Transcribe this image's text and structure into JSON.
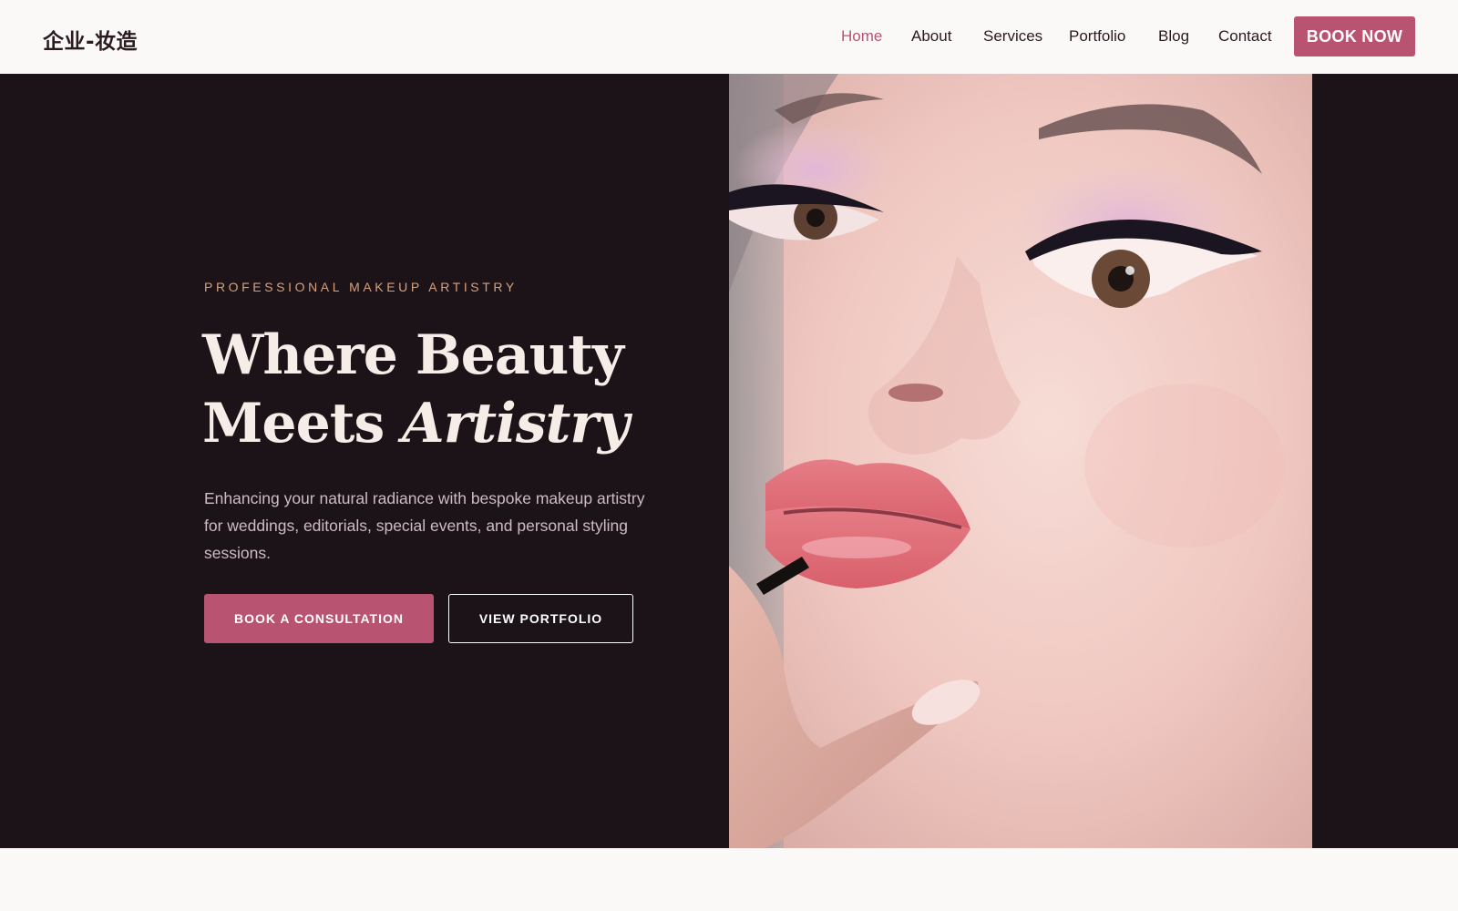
{
  "brand": {
    "logo_text": "企业-妆造"
  },
  "nav": {
    "items": [
      {
        "label": "Home",
        "active": true
      },
      {
        "label": "About"
      },
      {
        "label": "Services"
      },
      {
        "label": "Portfolio"
      },
      {
        "label": "Blog"
      },
      {
        "label": "Contact"
      }
    ],
    "cta_label": "BOOK NOW"
  },
  "hero": {
    "eyebrow": "PROFESSIONAL MAKEUP ARTISTRY",
    "headline_line1": "Where Beauty",
    "headline_line2_plain": "Meets ",
    "headline_line2_italic": "Artistry",
    "description": "Enhancing your natural radiance with bespoke makeup artistry for weddings, editorials, special events, and personal styling sessions.",
    "primary_button": "BOOK A CONSULTATION",
    "secondary_button": "VIEW PORTFOLIO"
  },
  "colors": {
    "accent": "#b85472",
    "hero_bg": "#1c1318",
    "eyebrow": "#d8a078",
    "page_bg": "#fbf9f7"
  }
}
